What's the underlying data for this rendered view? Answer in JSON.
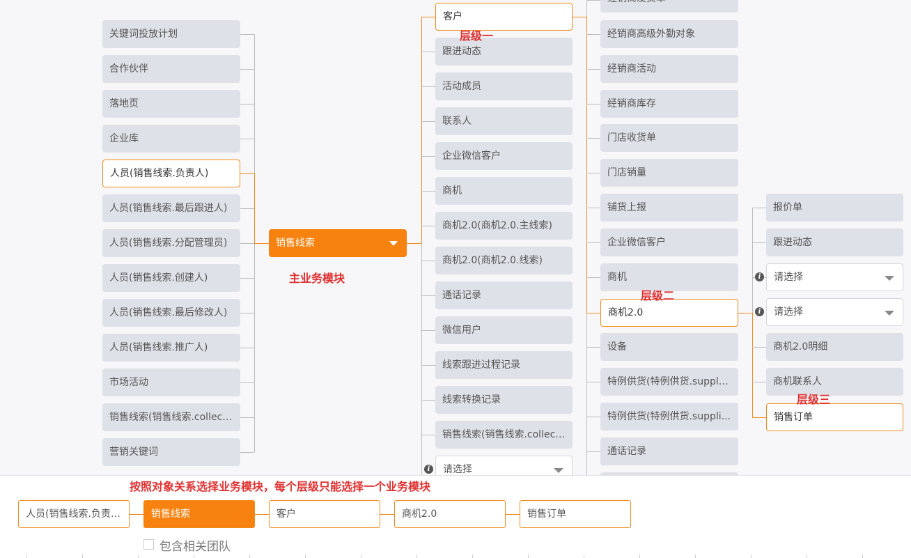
{
  "left_column": [
    {
      "label": "关键词投放计划",
      "selected": false
    },
    {
      "label": "合作伙伴",
      "selected": false
    },
    {
      "label": "落地页",
      "selected": false
    },
    {
      "label": "企业库",
      "selected": false
    },
    {
      "label": "人员(销售线索.负责人)",
      "selected": true
    },
    {
      "label": "人员(销售线索.最后跟进人)",
      "selected": false
    },
    {
      "label": "人员(销售线索.分配管理员)",
      "selected": false
    },
    {
      "label": "人员(销售线索.创建人)",
      "selected": false
    },
    {
      "label": "人员(销售线索.最后修改人)",
      "selected": false
    },
    {
      "label": "人员(销售线索.推广人)",
      "selected": false
    },
    {
      "label": "市场活动",
      "selected": false
    },
    {
      "label": "销售线索(销售线索.collect...",
      "selected": false
    },
    {
      "label": "营销关键词",
      "selected": false
    }
  ],
  "main_module": {
    "label": "销售线索"
  },
  "level1": [
    {
      "label": "客户",
      "selected": true
    },
    {
      "label": "跟进动态"
    },
    {
      "label": "活动成员"
    },
    {
      "label": "联系人"
    },
    {
      "label": "企业微信客户"
    },
    {
      "label": "商机"
    },
    {
      "label": "商机2.0(商机2.0.主线索)"
    },
    {
      "label": "商机2.0(商机2.0.线索)"
    },
    {
      "label": "通话记录"
    },
    {
      "label": "微信用户"
    },
    {
      "label": "线索跟进过程记录"
    },
    {
      "label": "线索转换记录"
    },
    {
      "label": "销售线索(销售线索.collect..."
    }
  ],
  "level1_select": {
    "placeholder": "请选择"
  },
  "level2": [
    {
      "label": "经销商发货单"
    },
    {
      "label": "经销商高级外勤对象"
    },
    {
      "label": "经销商活动"
    },
    {
      "label": "经销商库存"
    },
    {
      "label": "门店收货单"
    },
    {
      "label": "门店销量"
    },
    {
      "label": "铺货上报"
    },
    {
      "label": "企业微信客户"
    },
    {
      "label": "商机"
    },
    {
      "label": "商机2.0",
      "selected": true
    },
    {
      "label": "设备"
    },
    {
      "label": "特例供货(特例供货.supply..."
    },
    {
      "label": "特例供货(特例供货.suppli..."
    },
    {
      "label": "通话记录"
    }
  ],
  "level3": [
    {
      "label": "报价单",
      "type": "item"
    },
    {
      "label": "跟进动态",
      "type": "item"
    },
    {
      "label": "请选择",
      "type": "select"
    },
    {
      "label": "请选择",
      "type": "select"
    },
    {
      "label": "商机2.0明细",
      "type": "item"
    },
    {
      "label": "商机联系人",
      "type": "item"
    },
    {
      "label": "销售订单",
      "type": "item",
      "selected": true
    }
  ],
  "annotations": {
    "level1": "层级一",
    "main": "主业务模块",
    "level2": "层级二",
    "level3": "层级三",
    "instruction": "按照对象关系选择业务模块，每个层级只能选择一个业务模块"
  },
  "selection_path": [
    {
      "label": "人员(销售线索.负责人)",
      "active": false
    },
    {
      "label": "销售线索",
      "active": true
    },
    {
      "label": "客户",
      "active": false
    },
    {
      "label": "商机2.0",
      "active": false
    },
    {
      "label": "销售订单",
      "active": false
    }
  ],
  "include_team": {
    "label": "包含相关团队",
    "checked": false
  },
  "colors": {
    "accent": "#f7820f",
    "annotation": "#e03030",
    "node_bg": "#dfe1e8"
  }
}
